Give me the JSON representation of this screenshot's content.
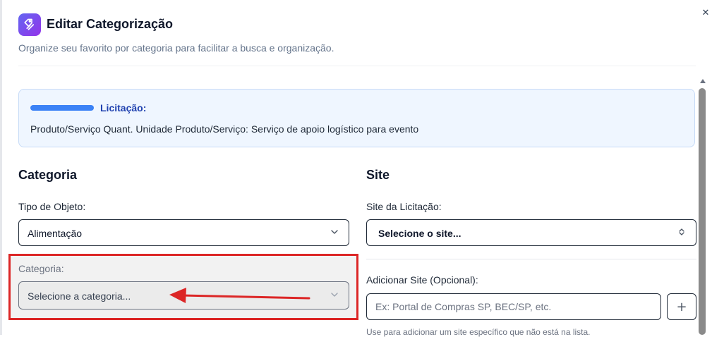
{
  "dialog": {
    "title": "Editar Categorização",
    "subtitle": "Organize seu favorito por categoria para facilitar a busca e organização.",
    "icon": "tag-icon",
    "close_icon": "close-icon",
    "close_glyph": "✕",
    "accent_gradient": [
      "#6366f1",
      "#9333ea"
    ]
  },
  "info": {
    "label": "Licitação:",
    "text": "Produto/Serviço Quant. Unidade Produto/Serviço: Serviço de apoio logístico para evento"
  },
  "categoria_section": {
    "title": "Categoria",
    "tipo_label": "Tipo de Objeto:",
    "tipo_value": "Alimentação",
    "categoria_label": "Categoria:",
    "categoria_placeholder": "Selecione a categoria..."
  },
  "site_section": {
    "title": "Site",
    "site_label": "Site da Licitação:",
    "site_placeholder": "Selecione o site...",
    "add_label": "Adicionar Site (Opcional):",
    "add_placeholder": "Ex: Portal de Compras SP, BEC/SP, etc.",
    "add_button_glyph": "+",
    "helper_text": "Use para adicionar um site específico que não está na lista."
  },
  "annotation": {
    "highlight_color": "#dc2626"
  }
}
